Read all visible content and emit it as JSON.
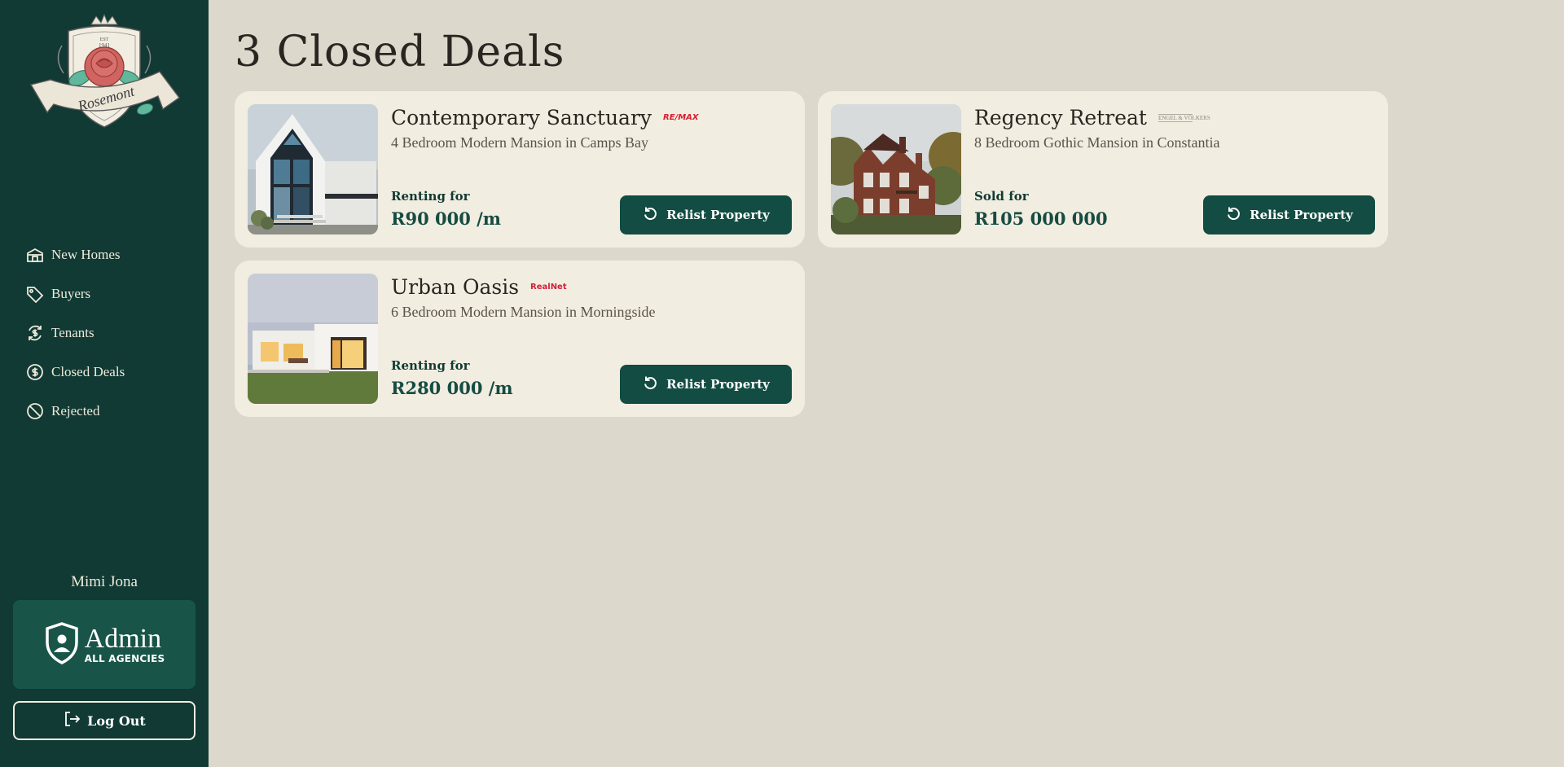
{
  "brand": {
    "name": "Rosemont",
    "est": "EST",
    "year": "1941"
  },
  "sidebar": {
    "items": [
      {
        "label": "New Homes",
        "icon": "house-icon"
      },
      {
        "label": "Buyers",
        "icon": "tag-icon"
      },
      {
        "label": "Tenants",
        "icon": "rent-cycle-icon"
      },
      {
        "label": "Closed Deals",
        "icon": "dollar-circle-icon"
      },
      {
        "label": "Rejected",
        "icon": "ban-icon"
      }
    ],
    "user_name": "Mimi Jona",
    "role": {
      "title": "Admin",
      "subtitle": "ALL AGENCIES",
      "icon": "shield-user-icon"
    },
    "logout_label": "Log Out"
  },
  "main": {
    "title": "3 Closed Deals",
    "deals": [
      {
        "name": "Contemporary Sanctuary",
        "agency": "RE/MAX",
        "description": "4 Bedroom Modern Mansion in Camps Bay",
        "price_label": "Renting for",
        "price": "R90 000 /m",
        "action": "Relist Property"
      },
      {
        "name": "Regency Retreat",
        "agency": "ENGEL & VÖLKERS",
        "description": "8 Bedroom Gothic Mansion in Constantia",
        "price_label": "Sold for",
        "price": "R105 000 000",
        "action": "Relist Property"
      },
      {
        "name": "Urban Oasis",
        "agency": "RealNet",
        "description": "6 Bedroom Modern Mansion in Morningside",
        "price_label": "Renting for",
        "price": "R280 000 /m",
        "action": "Relist Property"
      }
    ]
  },
  "colors": {
    "sidebar_bg": "#103a33",
    "page_bg": "#dcd8cc",
    "card_bg": "#f2ede1",
    "accent": "#124c42",
    "remax_red": "#dc1c2e",
    "realnet_red": "#d0213a"
  }
}
